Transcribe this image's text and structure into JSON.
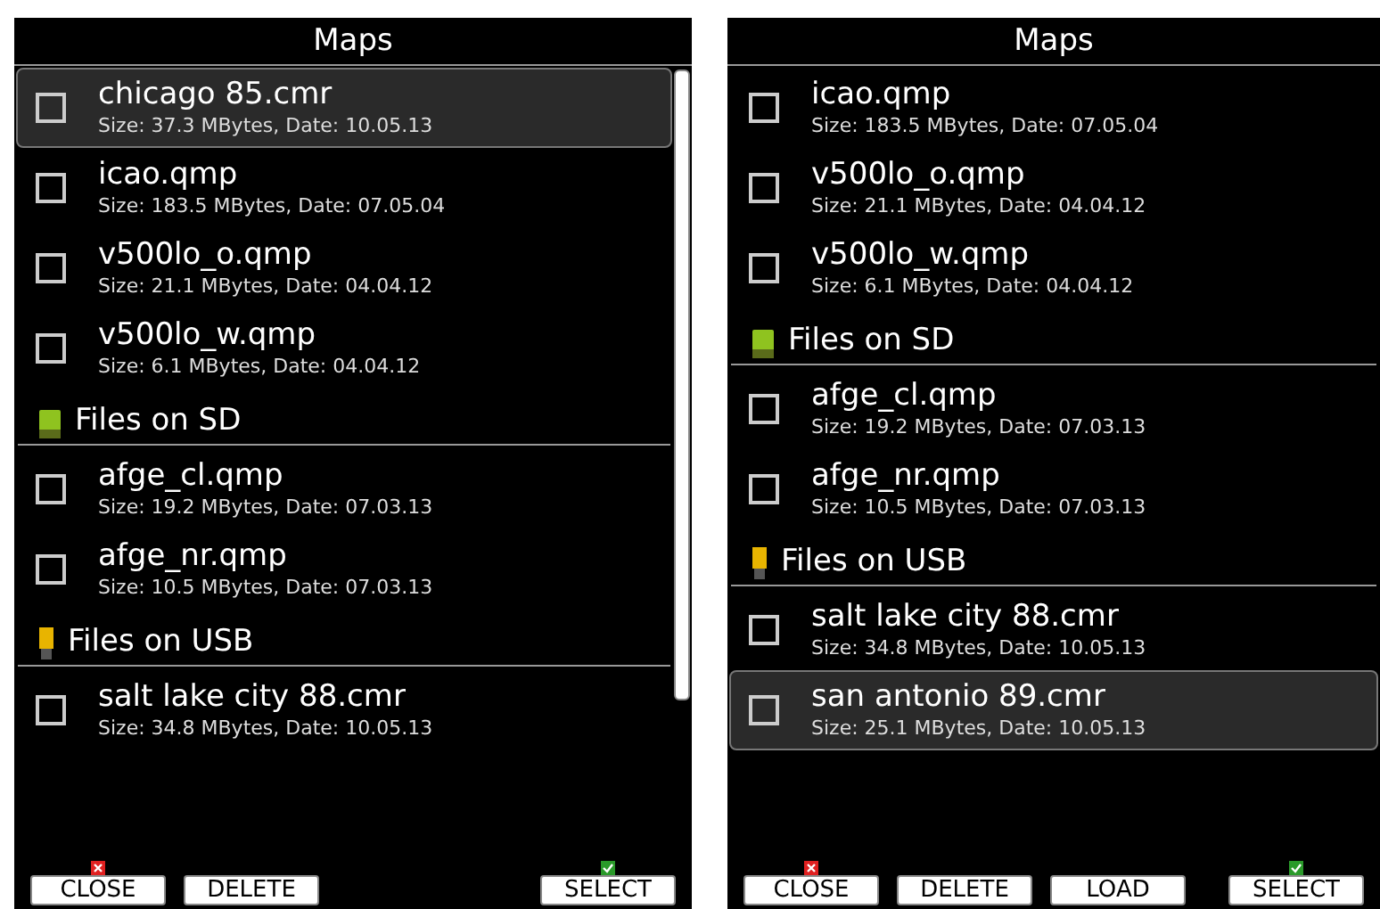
{
  "panels": [
    {
      "title": "Maps",
      "scrollbar": true,
      "items": [
        {
          "kind": "file",
          "name": "chicago 85.cmr",
          "details": "Size: 37.3 MBytes, Date: 10.05.13",
          "selected": true,
          "checked": false
        },
        {
          "kind": "file",
          "name": "icao.qmp",
          "details": "Size: 183.5 MBytes, Date: 07.05.04",
          "selected": false,
          "checked": false
        },
        {
          "kind": "file",
          "name": "v500lo_o.qmp",
          "details": "Size: 21.1 MBytes, Date: 04.04.12",
          "selected": false,
          "checked": false
        },
        {
          "kind": "file",
          "name": "v500lo_w.qmp",
          "details": "Size: 6.1 MBytes, Date: 04.04.12",
          "selected": false,
          "checked": false
        },
        {
          "kind": "sd",
          "label": "Files on SD"
        },
        {
          "kind": "file",
          "name": "afge_cl.qmp",
          "details": "Size: 19.2 MBytes, Date: 07.03.13",
          "selected": false,
          "checked": false
        },
        {
          "kind": "file",
          "name": "afge_nr.qmp",
          "details": "Size: 10.5 MBytes, Date: 07.03.13",
          "selected": false,
          "checked": false
        },
        {
          "kind": "usb",
          "label": "Files on USB"
        },
        {
          "kind": "file",
          "name": "salt lake city 88.cmr",
          "details": "Size: 34.8 MBytes, Date: 10.05.13",
          "selected": false,
          "checked": false
        }
      ],
      "buttons_left": [
        {
          "label": "CLOSE",
          "kind": "close"
        },
        {
          "label": "DELETE",
          "kind": "plain"
        }
      ],
      "buttons_right": [
        {
          "label": "SELECT",
          "kind": "select"
        }
      ]
    },
    {
      "title": "Maps",
      "scrollbar": false,
      "items": [
        {
          "kind": "file",
          "name": "icao.qmp",
          "details": "Size: 183.5 MBytes, Date: 07.05.04",
          "selected": false,
          "checked": false
        },
        {
          "kind": "file",
          "name": "v500lo_o.qmp",
          "details": "Size: 21.1 MBytes, Date: 04.04.12",
          "selected": false,
          "checked": false
        },
        {
          "kind": "file",
          "name": "v500lo_w.qmp",
          "details": "Size: 6.1 MBytes, Date: 04.04.12",
          "selected": false,
          "checked": false
        },
        {
          "kind": "sd",
          "label": "Files on SD"
        },
        {
          "kind": "file",
          "name": "afge_cl.qmp",
          "details": "Size: 19.2 MBytes, Date: 07.03.13",
          "selected": false,
          "checked": false
        },
        {
          "kind": "file",
          "name": "afge_nr.qmp",
          "details": "Size: 10.5 MBytes, Date: 07.03.13",
          "selected": false,
          "checked": false
        },
        {
          "kind": "usb",
          "label": "Files on USB"
        },
        {
          "kind": "file",
          "name": "salt lake city 88.cmr",
          "details": "Size: 34.8 MBytes, Date: 10.05.13",
          "selected": false,
          "checked": false
        },
        {
          "kind": "file",
          "name": "san antonio 89.cmr",
          "details": "Size: 25.1 MBytes, Date: 10.05.13",
          "selected": true,
          "checked": false
        }
      ],
      "buttons_left": [
        {
          "label": "CLOSE",
          "kind": "close"
        },
        {
          "label": "DELETE",
          "kind": "plain"
        },
        {
          "label": "LOAD",
          "kind": "plain"
        }
      ],
      "buttons_right": [
        {
          "label": "SELECT",
          "kind": "select"
        }
      ]
    }
  ]
}
